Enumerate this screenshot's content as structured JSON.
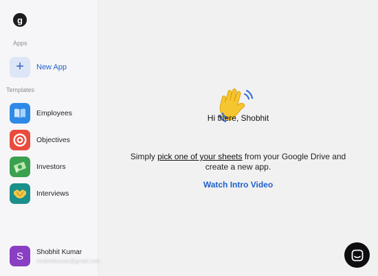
{
  "sidebar": {
    "logo_letter": "g",
    "apps_label": "Apps",
    "new_app_label": "New App",
    "templates_label": "Templates",
    "templates": [
      {
        "label": "Employees",
        "icon": "book-icon",
        "color": "#2d8ae6"
      },
      {
        "label": "Objectives",
        "icon": "target-icon",
        "color": "#e94b3c"
      },
      {
        "label": "Investors",
        "icon": "money-icon",
        "color": "#3aa14f"
      },
      {
        "label": "Interviews",
        "icon": "handshake-icon",
        "color": "#1b8f8a"
      }
    ],
    "user": {
      "initial": "S",
      "name": "Shobhit Kumar",
      "email": "shobhitkumar@gmail.com",
      "avatar_color": "#8a3ec4"
    }
  },
  "main": {
    "greeting": "Hi there, Shobhit",
    "message_prefix": "Simply ",
    "message_link": "pick one of your sheets",
    "message_mid": " from your Google Drive and",
    "message_line2": "create a new app.",
    "watch_label": "Watch Intro Video"
  },
  "colors": {
    "accent": "#1f5fcc",
    "sidebar_bg": "#f6f6f8",
    "main_bg": "#f1f1f2"
  }
}
